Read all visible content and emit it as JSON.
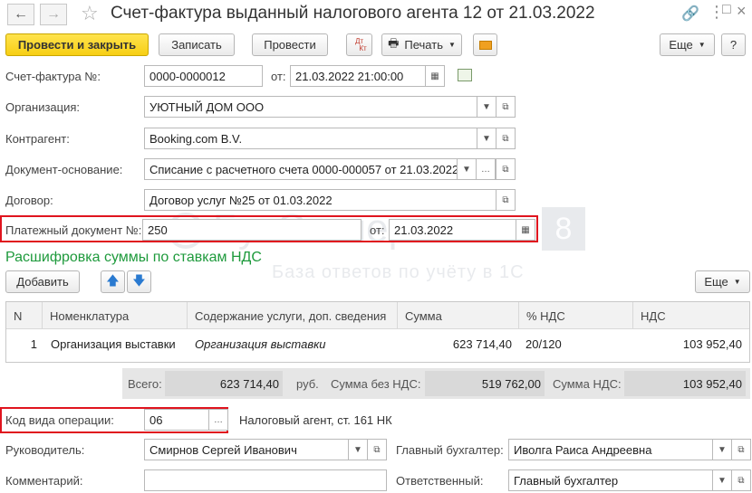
{
  "window": {
    "title": "Счет-фактура выданный налогового агента 12 от 21.03.2022"
  },
  "toolbar": {
    "post_close": "Провести и закрыть",
    "save": "Записать",
    "post": "Провести",
    "dtkt_top": "Дт",
    "dtkt_bottom": "Кт",
    "print": "Печать",
    "more": "Еще",
    "help": "?"
  },
  "form": {
    "invoice_label": "Счет-фактура №:",
    "invoice_number": "0000-0000012",
    "from_label": "от:",
    "invoice_date": "21.03.2022 21:00:00",
    "org_label": "Организация:",
    "org_value": "УЮТНЫЙ ДОМ ООО",
    "contractor_label": "Контрагент:",
    "contractor_value": "Booking.com B.V.",
    "base_doc_label": "Документ-основание:",
    "base_doc_value": "Списание с расчетного счета 0000-000057 от 21.03.2022",
    "contract_label": "Договор:",
    "contract_value": "Договор услуг №25 от 01.03.2022",
    "payment_doc_label": "Платежный документ №:",
    "payment_doc_value": "250",
    "payment_from_label": "от:",
    "payment_date": "21.03.2022"
  },
  "section": {
    "title": "Расшифровка суммы по ставкам НДС",
    "add_button": "Добавить",
    "more": "Еще"
  },
  "table": {
    "headers": [
      "N",
      "Номенклатура",
      "Содержание услуги, доп. сведения",
      "Сумма",
      "% НДС",
      "НДС"
    ],
    "rows": [
      {
        "n": "1",
        "item": "Организация выставки",
        "content": "Организация выставки",
        "sum": "623 714,40",
        "vat_rate": "20/120",
        "vat": "103 952,40"
      }
    ]
  },
  "totals": {
    "total_label": "Всего:",
    "total_value": "623 714,40",
    "currency": "руб.",
    "no_vat_label": "Сумма без НДС:",
    "no_vat_value": "519 762,00",
    "vat_label": "Сумма НДС:",
    "vat_value": "103 952,40"
  },
  "operation": {
    "code_label": "Код вида операции:",
    "code_value": "06",
    "code_desc": "Налоговый агент, ст. 161 НК"
  },
  "footer": {
    "manager_label": "Руководитель:",
    "manager_value": "Смирнов Сергей Иванович",
    "accountant_label": "Главный бухгалтер:",
    "accountant_value": "Иволга Раиса Андреевна",
    "comment_label": "Комментарий:",
    "comment_value": "",
    "responsible_label": "Ответственный:",
    "responsible_value": "Главный бухгалтер"
  },
  "watermark": {
    "logo_text": "БухЭксперт",
    "logo_number": "8",
    "tagline": "База ответов по учёту в 1С"
  },
  "colors": {
    "accent_yellow": "#f7cf14",
    "section_green": "#1e9a3c",
    "highlight_red": "#e0141e"
  }
}
